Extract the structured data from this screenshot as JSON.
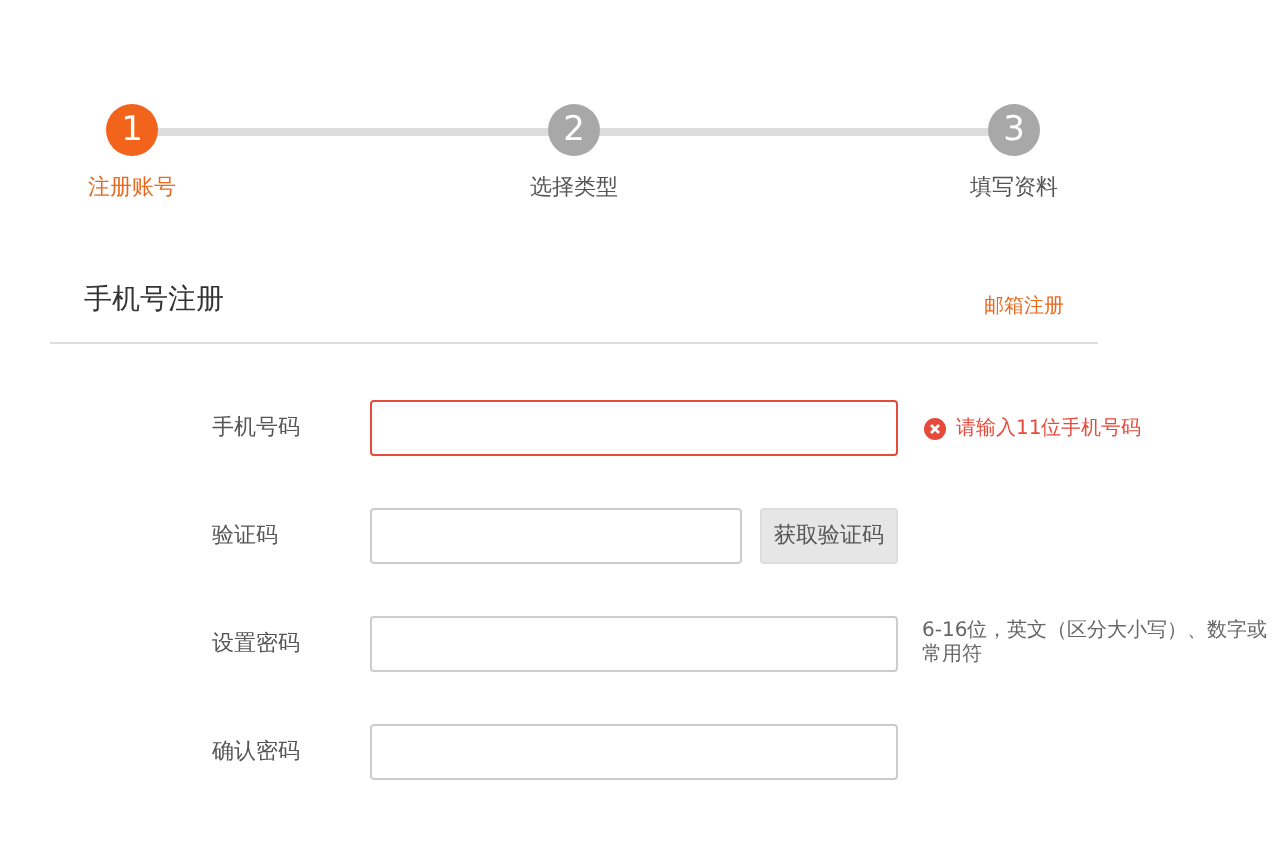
{
  "steps": [
    {
      "number": "1",
      "label": "注册账号",
      "selected": true
    },
    {
      "number": "2",
      "label": "选择类型",
      "selected": false
    },
    {
      "number": "3",
      "label": "填写资料",
      "selected": false
    }
  ],
  "form_title": "手机号注册",
  "switch_link": "邮箱注册",
  "fields": [
    {
      "label": "手机号码",
      "kind": "input",
      "error": true,
      "message": "请输入11位手机号码"
    },
    {
      "label": "验证码",
      "kind": "code",
      "error": false,
      "button": "获取验证码"
    },
    {
      "label": "设置密码",
      "kind": "input",
      "error": false,
      "hint": "6-16位，英文（区分大小写）、数字或常用符"
    },
    {
      "label": "确认密码",
      "kind": "input",
      "error": false
    }
  ]
}
